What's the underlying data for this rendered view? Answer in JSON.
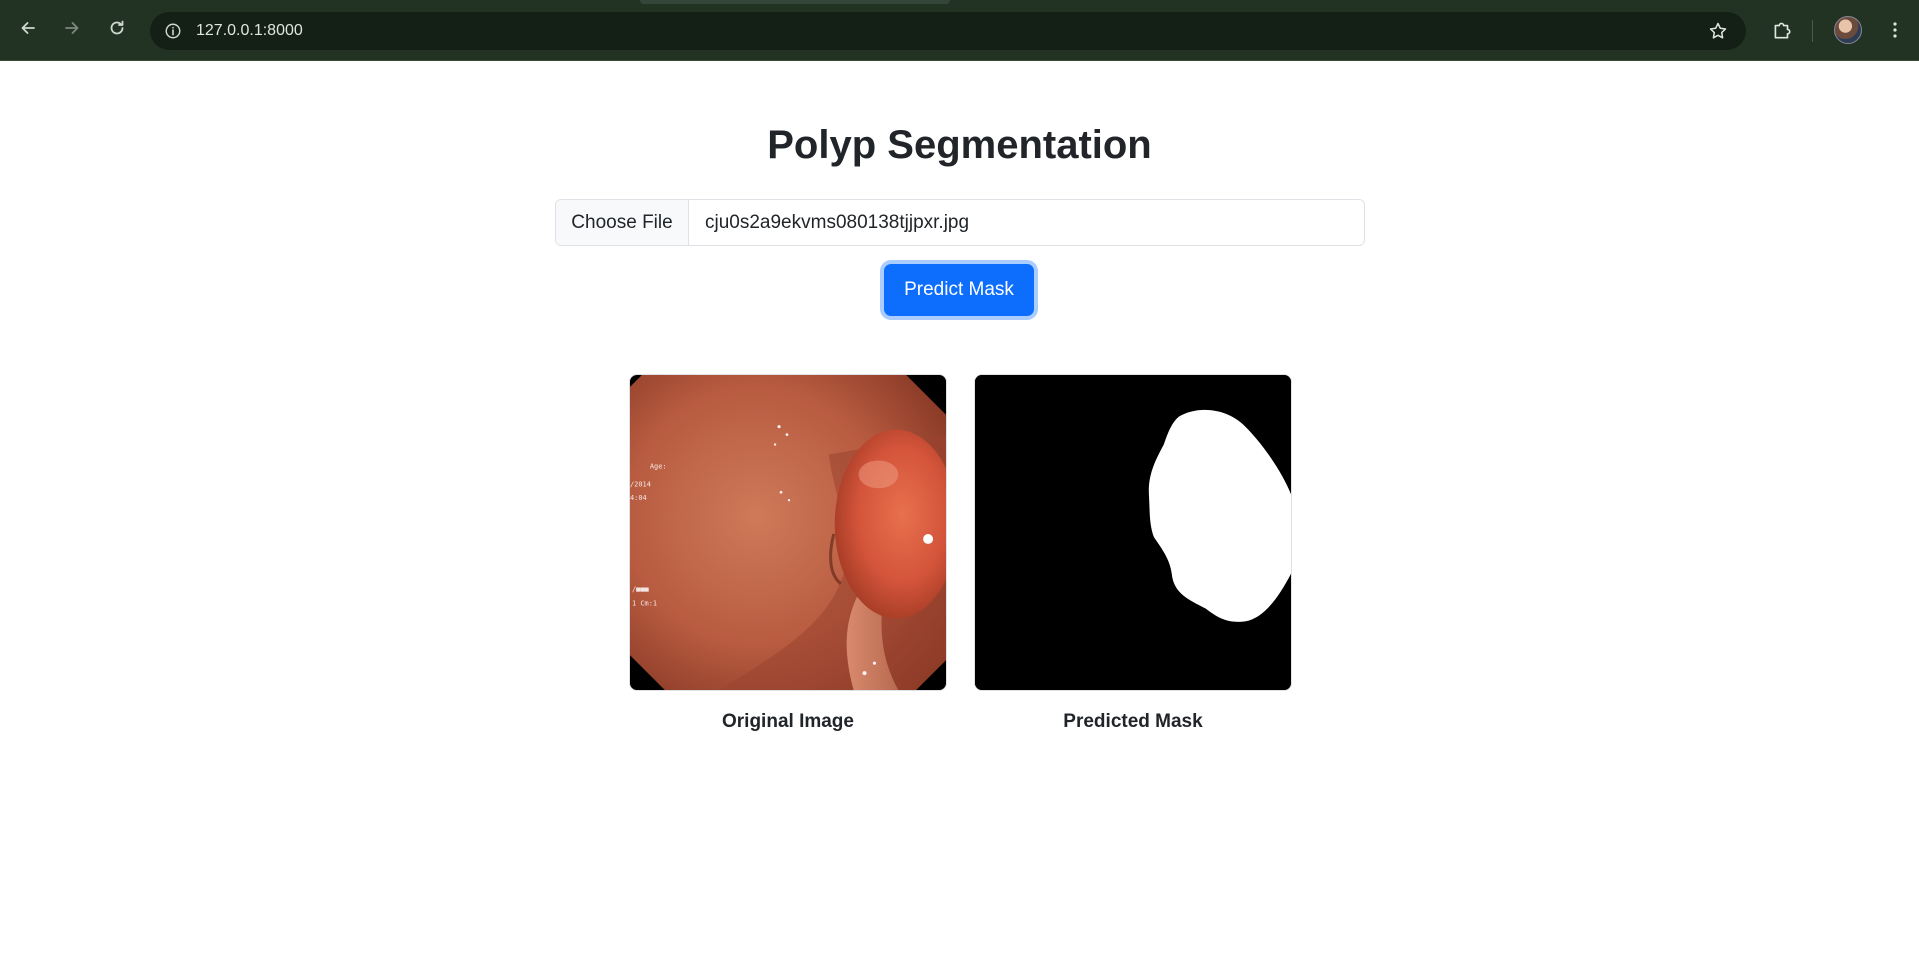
{
  "browser": {
    "url": "127.0.0.1:8000",
    "icons": [
      "back-icon",
      "forward-icon",
      "reload-icon",
      "site-info-icon",
      "bookmark-star-icon",
      "extensions-icon",
      "profile-avatar",
      "menu-kebab-icon"
    ]
  },
  "page": {
    "title": "Polyp Segmentation",
    "file_input": {
      "button_label": "Choose File",
      "file_name": "cju0s2a9ekvms080138tjjpxr.jpg"
    },
    "predict_button": "Predict Mask",
    "results": [
      {
        "caption": "Original Image"
      },
      {
        "caption": "Predicted Mask"
      }
    ],
    "accent_color": "#0d6efd"
  }
}
